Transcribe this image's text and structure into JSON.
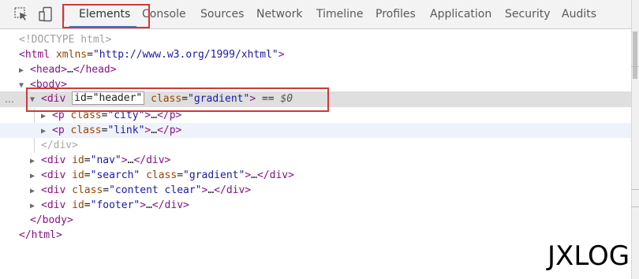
{
  "toolbar": {
    "icons": [
      "inspect-element-icon",
      "device-mode-icon"
    ],
    "tabs": [
      {
        "label": "Elements",
        "active": true
      },
      {
        "label": "Console"
      },
      {
        "label": "Sources"
      },
      {
        "label": "Network"
      },
      {
        "label": "Timeline"
      },
      {
        "label": "Profiles"
      },
      {
        "label": "Application"
      },
      {
        "label": "Security"
      },
      {
        "label": "Audits"
      }
    ]
  },
  "dom": {
    "doctype": "<!DOCTYPE html>",
    "html_open": {
      "tag": "<html",
      "attr": "xmlns",
      "value": "\"http://www.w3.org/1999/xhtml\"",
      "close": ">"
    },
    "head": {
      "open": "<head>",
      "ellipsis": "…",
      "close": "</head>"
    },
    "body_open": "<body>",
    "selected": {
      "tag": "<div",
      "editing_attr": "id=\"header\"",
      "attr2": "class",
      "value2": "\"gradient\"",
      "close": ">",
      "eq": "==",
      "ref": "$0"
    },
    "children": [
      {
        "tag": "<p",
        "attr": "class",
        "value": "\"city\"",
        "close": ">",
        "ellipsis": "…",
        "end": "</p>"
      },
      {
        "tag": "<p",
        "attr": "class",
        "value": "\"link\"",
        "close": ">",
        "ellipsis": "…",
        "end": "</p>"
      }
    ],
    "div_close": "</div>",
    "siblings": [
      {
        "tag": "<div",
        "attr": "id",
        "value": "\"nav\"",
        "close": ">",
        "ellipsis": "…",
        "end": "</div>"
      },
      {
        "tag": "<div",
        "attr": "id",
        "value": "\"search\"",
        "attr2": "class",
        "value2": "\"gradient\"",
        "close": ">",
        "ellipsis": "…",
        "end": "</div>"
      },
      {
        "tag": "<div",
        "attr": "class",
        "value": "\"content clear\"",
        "close": ">",
        "ellipsis": "…",
        "end": "</div>"
      },
      {
        "tag": "<div",
        "attr": "id",
        "value": "\"footer\"",
        "close": ">",
        "ellipsis": "…",
        "end": "</div>"
      }
    ],
    "body_close": "</body>",
    "html_close": "</html>",
    "gutter_mark": "…"
  },
  "watermark": "JXLOG",
  "colors": {
    "tag": "#881280",
    "attr_name": "#994500",
    "attr_value": "#1a1aa6",
    "annotation": "#d03838",
    "active_tab_underline": "#3879d9",
    "selected_row": "#dfdfdf"
  }
}
